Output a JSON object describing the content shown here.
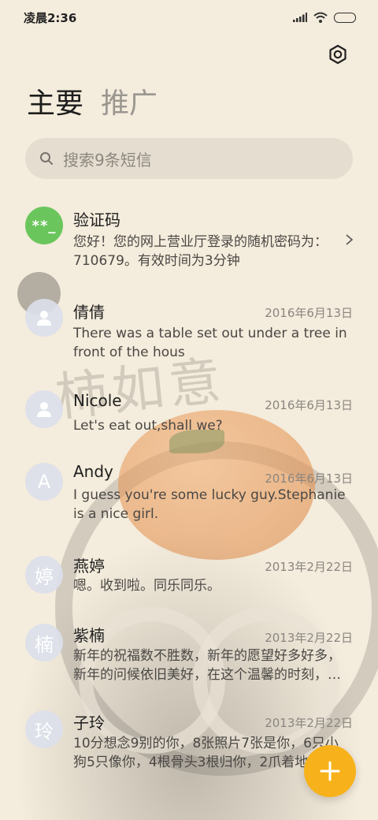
{
  "status_bar": {
    "time": "凌晨2:36"
  },
  "tabs": [
    {
      "label": "主要",
      "active": true
    },
    {
      "label": "推广",
      "active": false
    }
  ],
  "search": {
    "placeholder": "搜索9条短信"
  },
  "conversations": [
    {
      "avatar": "**_",
      "name": "验证码",
      "date": "",
      "preview": "您好！您的网上营业厅登录的随机密码为：710679。有效时间为3分钟"
    },
    {
      "avatar": "person-icon",
      "name": "倩倩",
      "date": "2016年6月13日",
      "preview": "There was a table set out under a tree in front of the hous"
    },
    {
      "avatar": "person-icon",
      "name": "Nicole",
      "date": "2016年6月13日",
      "preview": "Let's eat out,shall we?"
    },
    {
      "avatar": "A",
      "name": "Andy",
      "date": "2016年6月13日",
      "preview": "I guess you're some lucky guy.Stephanie is a nice girl."
    },
    {
      "avatar": "婷",
      "name": "燕婷",
      "date": "2013年2月22日",
      "preview": "嗯。收到啦。同乐同乐。"
    },
    {
      "avatar": "楠",
      "name": "紫楠",
      "date": "2013年2月22日",
      "preview": "新年的祝福数不胜数，新年的愿望好多好多，新年的问候依旧美好，在这个温馨的时刻，…"
    },
    {
      "avatar": "玲",
      "name": "子玲",
      "date": "2013年2月22日",
      "preview": "10分想念9别的你，8张照片7张是你，6只小狗5只像你，4根骨头3根归你，2爪着地"
    }
  ],
  "fab": {
    "icon": "plus-icon"
  },
  "background": {
    "calligraphy": "柿如意"
  },
  "colors": {
    "accent": "#f7b21b",
    "verify_avatar": "#6ac65c"
  }
}
